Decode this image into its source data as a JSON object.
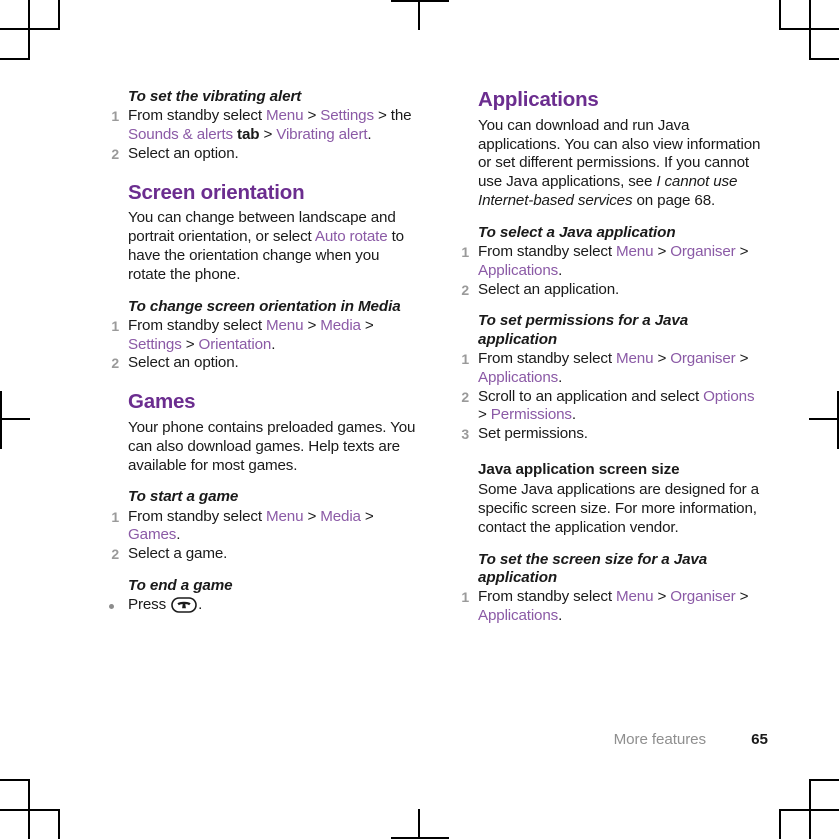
{
  "document": {
    "footer": {
      "section": "More features",
      "page_number": "65"
    }
  },
  "left_column": {
    "proc_vibrating": {
      "heading": "To set the vibrating alert",
      "steps": [
        {
          "num": "1",
          "parts": [
            {
              "t": "From standby select ",
              "s": "plain"
            },
            {
              "t": "Menu",
              "s": "link"
            },
            {
              "t": " > ",
              "s": "plain"
            },
            {
              "t": "Settings",
              "s": "link"
            },
            {
              "t": " > the ",
              "s": "plain"
            },
            {
              "t": "Sounds & alerts",
              "s": "link"
            },
            {
              "t": " tab",
              "s": "bold"
            },
            {
              "t": " > ",
              "s": "plain"
            },
            {
              "t": "Vibrating alert",
              "s": "link"
            },
            {
              "t": ".",
              "s": "plain"
            }
          ]
        },
        {
          "num": "2",
          "parts": [
            {
              "t": "Select an option.",
              "s": "plain"
            }
          ]
        }
      ]
    },
    "screen_orientation": {
      "heading": "Screen orientation",
      "body": [
        {
          "t": "You can change between landscape and portrait orientation, or select ",
          "s": "plain"
        },
        {
          "t": "Auto rotate",
          "s": "link"
        },
        {
          "t": " to have the orientation change when you rotate the phone.",
          "s": "plain"
        }
      ]
    },
    "proc_change_orientation": {
      "heading": "To change screen orientation in Media",
      "steps": [
        {
          "num": "1",
          "parts": [
            {
              "t": "From standby select ",
              "s": "plain"
            },
            {
              "t": "Menu",
              "s": "link"
            },
            {
              "t": " > ",
              "s": "plain"
            },
            {
              "t": "Media",
              "s": "link"
            },
            {
              "t": " > ",
              "s": "plain"
            },
            {
              "t": "Settings",
              "s": "link"
            },
            {
              "t": " > ",
              "s": "plain"
            },
            {
              "t": "Orientation",
              "s": "link"
            },
            {
              "t": ".",
              "s": "plain"
            }
          ]
        },
        {
          "num": "2",
          "parts": [
            {
              "t": "Select an option.",
              "s": "plain"
            }
          ]
        }
      ]
    },
    "games": {
      "heading": "Games",
      "body": [
        {
          "t": "Your phone contains preloaded games. You can also download games. Help texts are available for most games.",
          "s": "plain"
        }
      ]
    },
    "proc_start_game": {
      "heading": "To start a game",
      "steps": [
        {
          "num": "1",
          "parts": [
            {
              "t": "From standby select ",
              "s": "plain"
            },
            {
              "t": "Menu",
              "s": "link"
            },
            {
              "t": " > ",
              "s": "plain"
            },
            {
              "t": "Media",
              "s": "link"
            },
            {
              "t": " > ",
              "s": "plain"
            },
            {
              "t": "Games",
              "s": "link"
            },
            {
              "t": ".",
              "s": "plain"
            }
          ]
        },
        {
          "num": "2",
          "parts": [
            {
              "t": "Select a game.",
              "s": "plain"
            }
          ]
        }
      ]
    },
    "proc_end_game": {
      "heading": "To end a game",
      "step_prefix": "Press ",
      "step_icon": "end-call-key-icon",
      "step_suffix": "."
    }
  },
  "right_column": {
    "applications": {
      "heading": "Applications",
      "body": [
        {
          "t": "You can download and run Java applications. You can also view information or set different permissions. If you cannot use Java applications, see ",
          "s": "plain"
        },
        {
          "t": "I cannot use Internet-based services",
          "s": "italic"
        },
        {
          "t": " on page 68.",
          "s": "plain"
        }
      ]
    },
    "proc_select_java_app": {
      "heading": "To select a Java application",
      "steps": [
        {
          "num": "1",
          "parts": [
            {
              "t": "From standby select ",
              "s": "plain"
            },
            {
              "t": "Menu",
              "s": "link"
            },
            {
              "t": " > ",
              "s": "plain"
            },
            {
              "t": "Organiser",
              "s": "link"
            },
            {
              "t": " > ",
              "s": "plain"
            },
            {
              "t": "Applications",
              "s": "link"
            },
            {
              "t": ".",
              "s": "plain"
            }
          ]
        },
        {
          "num": "2",
          "parts": [
            {
              "t": "Select an application.",
              "s": "plain"
            }
          ]
        }
      ]
    },
    "proc_set_permissions": {
      "heading": "To set permissions for a Java application",
      "steps": [
        {
          "num": "1",
          "parts": [
            {
              "t": "From standby select ",
              "s": "plain"
            },
            {
              "t": "Menu",
              "s": "link"
            },
            {
              "t": " > ",
              "s": "plain"
            },
            {
              "t": "Organiser",
              "s": "link"
            },
            {
              "t": " > ",
              "s": "plain"
            },
            {
              "t": "Applications",
              "s": "link"
            },
            {
              "t": ".",
              "s": "plain"
            }
          ]
        },
        {
          "num": "2",
          "parts": [
            {
              "t": "Scroll to an application and select ",
              "s": "plain"
            },
            {
              "t": "Options",
              "s": "link"
            },
            {
              "t": " > ",
              "s": "plain"
            },
            {
              "t": "Permissions",
              "s": "link"
            },
            {
              "t": ".",
              "s": "plain"
            }
          ]
        },
        {
          "num": "3",
          "parts": [
            {
              "t": "Set permissions.",
              "s": "plain"
            }
          ]
        }
      ]
    },
    "java_screen_size": {
      "heading": "Java application screen size",
      "body": [
        {
          "t": "Some Java applications are designed for a specific screen size. For more information, contact the application vendor.",
          "s": "plain"
        }
      ]
    },
    "proc_set_screen_size": {
      "heading": "To set the screen size for a Java application",
      "steps": [
        {
          "num": "1",
          "parts": [
            {
              "t": "From standby select ",
              "s": "plain"
            },
            {
              "t": "Menu",
              "s": "link"
            },
            {
              "t": " > ",
              "s": "plain"
            },
            {
              "t": "Organiser",
              "s": "link"
            },
            {
              "t": " > ",
              "s": "plain"
            },
            {
              "t": "Applications",
              "s": "link"
            },
            {
              "t": ".",
              "s": "plain"
            }
          ]
        }
      ]
    }
  },
  "colors": {
    "heading_purple": "#6b2d8f",
    "link_purple": "#8b5aa6",
    "step_number_gray": "#9a9a9a",
    "footer_gray": "#8f8f8f",
    "text_black": "#1a1a1a"
  }
}
